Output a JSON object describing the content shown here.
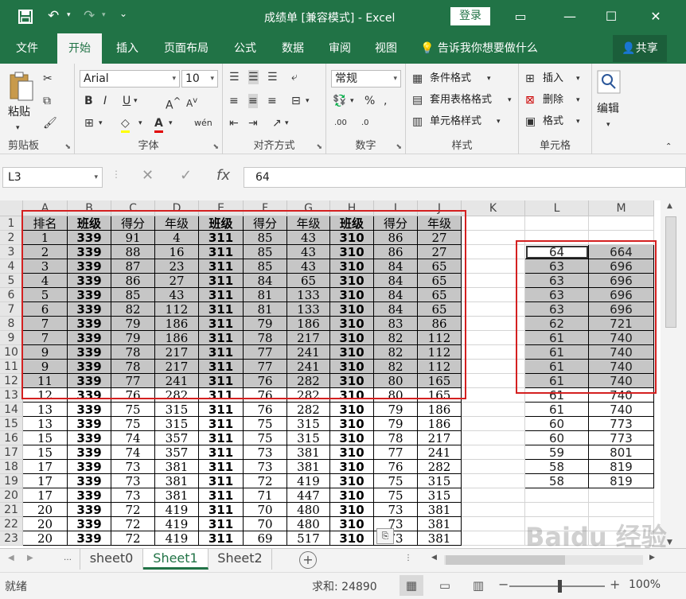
{
  "titlebar": {
    "title": "成绩单 [兼容模式] - Excel",
    "login": "登录"
  },
  "tabs": [
    "文件",
    "开始",
    "插入",
    "页面布局",
    "公式",
    "数据",
    "审阅",
    "视图"
  ],
  "tellme": "告诉我你想要做什么",
  "share": "共享",
  "ribbon": {
    "paste": "粘贴",
    "font_name": "Arial",
    "font_size": "10",
    "number_format": "常规",
    "cond_format": "条件格式",
    "table_format": "套用表格格式",
    "cell_style": "单元格样式",
    "insert": "插入",
    "delete": "删除",
    "format": "格式",
    "edit": "编辑",
    "groups": {
      "clipboard": "剪贴板",
      "font": "字体",
      "align": "对齐方式",
      "number": "数字",
      "style": "样式",
      "cells": "单元格"
    }
  },
  "formula": {
    "namebox": "L3",
    "value": "64"
  },
  "columns": [
    "A",
    "B",
    "C",
    "D",
    "E",
    "F",
    "G",
    "H",
    "I",
    "J",
    "K",
    "L",
    "M"
  ],
  "header_row": [
    "排名",
    "班级",
    "得分",
    "年级",
    "班级",
    "得分",
    "年级",
    "班级",
    "得分",
    "年级"
  ],
  "rows": [
    [
      "1",
      "339",
      "91",
      "4",
      "311",
      "85",
      "43",
      "310",
      "86",
      "27"
    ],
    [
      "2",
      "339",
      "88",
      "16",
      "311",
      "85",
      "43",
      "310",
      "86",
      "27"
    ],
    [
      "3",
      "339",
      "87",
      "23",
      "311",
      "85",
      "43",
      "310",
      "84",
      "65"
    ],
    [
      "4",
      "339",
      "86",
      "27",
      "311",
      "84",
      "65",
      "310",
      "84",
      "65"
    ],
    [
      "5",
      "339",
      "85",
      "43",
      "311",
      "81",
      "133",
      "310",
      "84",
      "65"
    ],
    [
      "6",
      "339",
      "82",
      "112",
      "311",
      "81",
      "133",
      "310",
      "84",
      "65"
    ],
    [
      "7",
      "339",
      "79",
      "186",
      "311",
      "79",
      "186",
      "310",
      "83",
      "86"
    ],
    [
      "7",
      "339",
      "79",
      "186",
      "311",
      "78",
      "217",
      "310",
      "82",
      "112"
    ],
    [
      "9",
      "339",
      "78",
      "217",
      "311",
      "77",
      "241",
      "310",
      "82",
      "112"
    ],
    [
      "9",
      "339",
      "78",
      "217",
      "311",
      "77",
      "241",
      "310",
      "82",
      "112"
    ],
    [
      "11",
      "339",
      "77",
      "241",
      "311",
      "76",
      "282",
      "310",
      "80",
      "165"
    ],
    [
      "12",
      "339",
      "76",
      "282",
      "311",
      "76",
      "282",
      "310",
      "80",
      "165"
    ],
    [
      "13",
      "339",
      "75",
      "315",
      "311",
      "76",
      "282",
      "310",
      "79",
      "186"
    ],
    [
      "13",
      "339",
      "75",
      "315",
      "311",
      "75",
      "315",
      "310",
      "79",
      "186"
    ],
    [
      "15",
      "339",
      "74",
      "357",
      "311",
      "75",
      "315",
      "310",
      "78",
      "217"
    ],
    [
      "15",
      "339",
      "74",
      "357",
      "311",
      "73",
      "381",
      "310",
      "77",
      "241"
    ],
    [
      "17",
      "339",
      "73",
      "381",
      "311",
      "73",
      "381",
      "310",
      "76",
      "282"
    ],
    [
      "17",
      "339",
      "73",
      "381",
      "311",
      "72",
      "419",
      "310",
      "75",
      "315"
    ],
    [
      "17",
      "339",
      "73",
      "381",
      "311",
      "71",
      "447",
      "310",
      "75",
      "315"
    ],
    [
      "20",
      "339",
      "72",
      "419",
      "311",
      "70",
      "480",
      "310",
      "73",
      "381"
    ],
    [
      "20",
      "339",
      "72",
      "419",
      "311",
      "70",
      "480",
      "310",
      "73",
      "381"
    ],
    [
      "20",
      "339",
      "72",
      "419",
      "311",
      "69",
      "517",
      "310",
      "73",
      "381"
    ]
  ],
  "lm": [
    [
      "64",
      "664"
    ],
    [
      "63",
      "696"
    ],
    [
      "63",
      "696"
    ],
    [
      "63",
      "696"
    ],
    [
      "63",
      "696"
    ],
    [
      "62",
      "721"
    ],
    [
      "61",
      "740"
    ],
    [
      "61",
      "740"
    ],
    [
      "61",
      "740"
    ],
    [
      "61",
      "740"
    ],
    [
      "61",
      "740"
    ],
    [
      "61",
      "740"
    ],
    [
      "60",
      "773"
    ],
    [
      "60",
      "773"
    ],
    [
      "59",
      "801"
    ],
    [
      "58",
      "819"
    ],
    [
      "58",
      "819"
    ]
  ],
  "sheets": [
    "sheet0",
    "Sheet1",
    "Sheet2"
  ],
  "active_sheet": 1,
  "status": {
    "ready": "就绪",
    "sum": "求和: 24890",
    "zoom": "100%"
  },
  "watermark": "Baidu 经验"
}
